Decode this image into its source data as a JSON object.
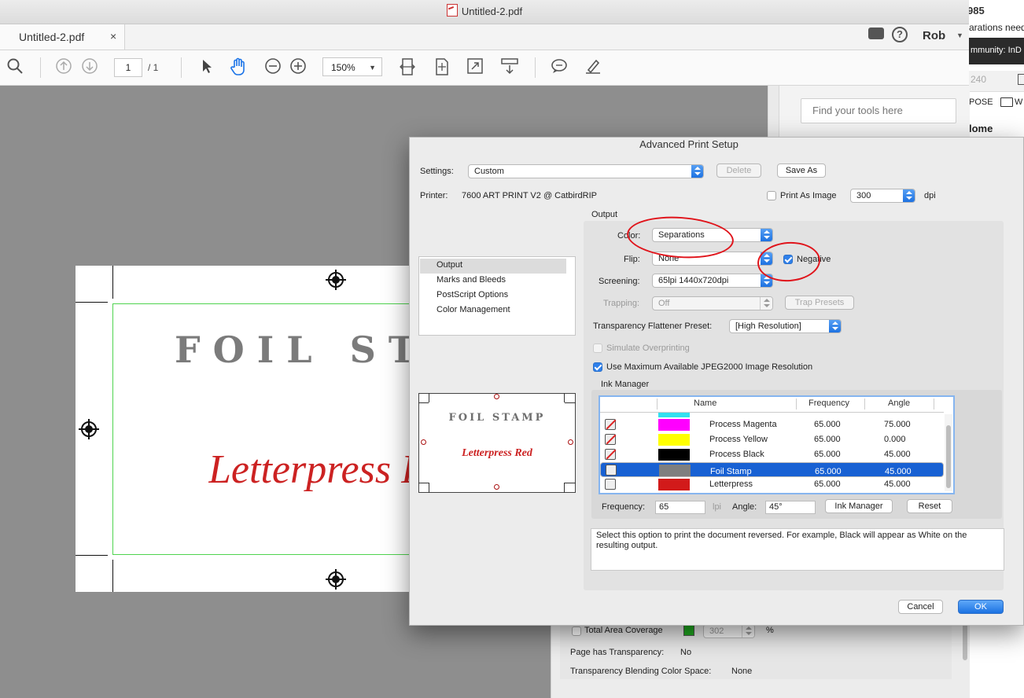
{
  "window": {
    "title": "Untitled-2.pdf",
    "tab_label": "Untitled-2.pdf",
    "tab_close": "×",
    "user": "Rob"
  },
  "toolbar": {
    "page_current": "1",
    "page_total": "/ 1",
    "zoom": "150%"
  },
  "right_pane": {
    "search_placeholder": "Find your tools here"
  },
  "background_window": {
    "number": "985",
    "line1": "arations need",
    "community": "mmunity: InD",
    "field_value": "240",
    "pose": "POSE",
    "w_label": "W",
    "home": "lome"
  },
  "document": {
    "heading": "FOIL STAMP",
    "subheading": "Letterpress Red"
  },
  "dialog": {
    "title": "Advanced Print Setup",
    "settings_label": "Settings:",
    "settings_value": "Custom",
    "delete_label": "Delete",
    "save_as_label": "Save As",
    "printer_label": "Printer:",
    "printer_value": "7600 ART PRINT V2 @ CatbirdRIP",
    "print_as_image_label": "Print As Image",
    "dpi_value": "300",
    "dpi_unit": "dpi",
    "section_list": [
      "Output",
      "Marks and Bleeds",
      "PostScript Options",
      "Color Management"
    ],
    "output_group_label": "Output",
    "color_label": "Color:",
    "color_value": "Separations",
    "flip_label": "Flip:",
    "flip_value": "None",
    "negative_label": "Negative",
    "screening_label": "Screening:",
    "screening_value": "65lpi 1440x720dpi",
    "trapping_label": "Trapping:",
    "trapping_value": "Off",
    "trap_presets_label": "Trap Presets",
    "flattener_label": "Transparency Flattener Preset:",
    "flattener_value": "[High Resolution]",
    "simulate_overprinting_label": "Simulate Overprinting",
    "use_max_jpeg_label": "Use Maximum Available JPEG2000 Image Resolution",
    "ink_manager_group_label": "Ink Manager",
    "table_headers": {
      "name": "Name",
      "frequency": "Frequency",
      "angle": "Angle"
    },
    "inks": [
      {
        "name": "Process Magenta",
        "frequency": "65.000",
        "angle": "75.000",
        "color": "#ff00ff",
        "printing": false
      },
      {
        "name": "Process Yellow",
        "frequency": "65.000",
        "angle": "0.000",
        "color": "#ffff00",
        "printing": false
      },
      {
        "name": "Process Black",
        "frequency": "65.000",
        "angle": "45.000",
        "color": "#000000",
        "printing": false
      },
      {
        "name": "Foil Stamp",
        "frequency": "65.000",
        "angle": "45.000",
        "color": "#7f7f7f",
        "printing": true
      },
      {
        "name": "Letterpress",
        "frequency": "65.000",
        "angle": "45.000",
        "color": "#d21a1a",
        "printing": true
      }
    ],
    "frequency_label": "Frequency:",
    "frequency_value": "65",
    "lpi_label": "lpi",
    "angle_label": "Angle:",
    "angle_value": "45°",
    "ink_manager_button": "Ink Manager",
    "reset_button": "Reset",
    "description": "Select this option to print the document reversed. For example, Black will appear as White on the resulting output.",
    "cancel_label": "Cancel",
    "ok_label": "OK"
  },
  "back_panel": {
    "total_area_label": "Total Area Coverage",
    "total_area_value": "302",
    "percent": "%",
    "transparency_label": "Page has Transparency:",
    "transparency_value": "No",
    "blending_label": "Transparency Blending Color Space:",
    "blending_value": "None"
  },
  "colors": {
    "accent": "#1861d3",
    "annotation_red": "#e0141b",
    "crop_green": "#4fd34f"
  }
}
